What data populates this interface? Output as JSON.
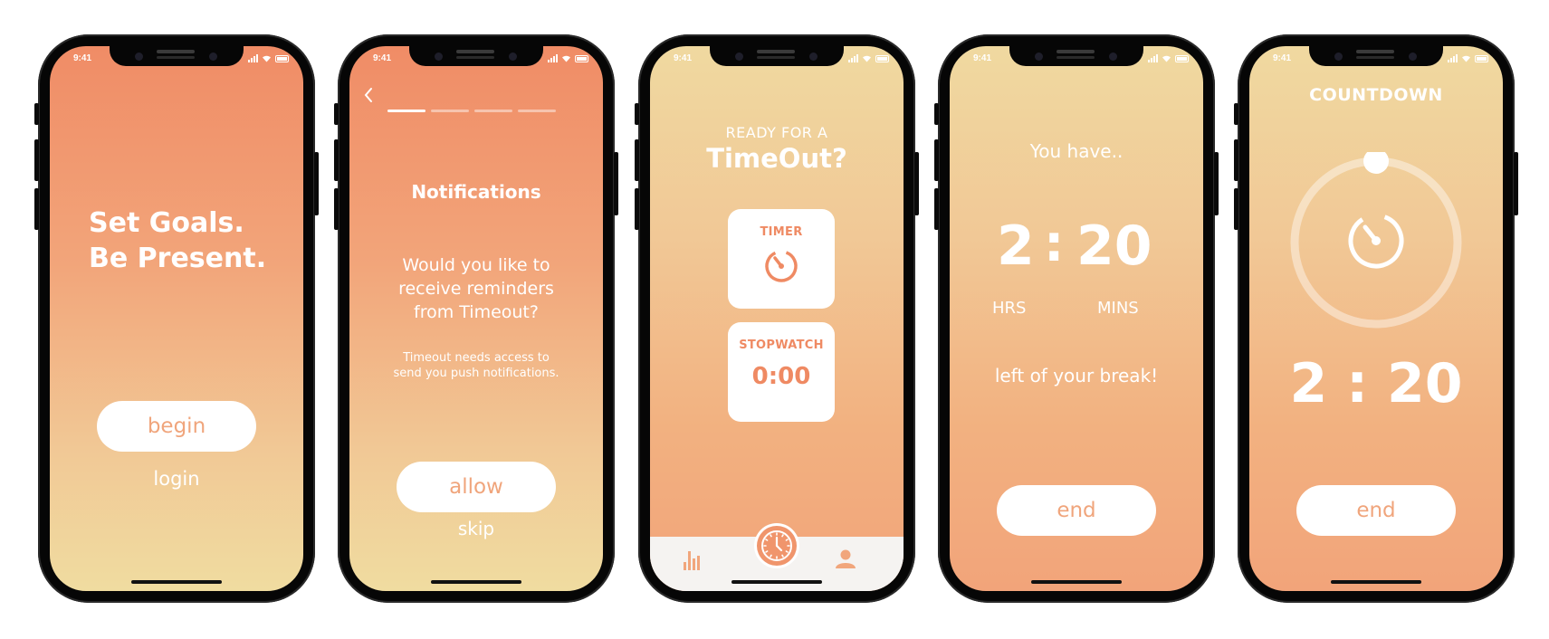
{
  "status": {
    "time": "9:41"
  },
  "screen1": {
    "headline_line1": "Set Goals.",
    "headline_line2": "Be Present.",
    "begin_button": "begin",
    "login_link": "login"
  },
  "screen2": {
    "title": "Notifications",
    "question": "Would you like to receive reminders from Timeout?",
    "description": "Timeout needs access to send you push notifications.",
    "progress_steps": 4,
    "progress_active_index": 0,
    "allow_button": "allow",
    "skip_link": "skip"
  },
  "screen3": {
    "subtitle": "READY FOR A",
    "title": "TimeOut?",
    "timer_card_label": "TIMER",
    "stopwatch_card_label": "STOPWATCH",
    "stopwatch_value": "0:00",
    "tabs": [
      "stats-icon",
      "clock-icon",
      "profile-icon"
    ]
  },
  "screen4": {
    "intro": "You have..",
    "hours": "2",
    "separator": ":",
    "minutes": "20",
    "hours_label": "HRS",
    "minutes_label": "MINS",
    "outro": "left of your break!",
    "end_button": "end"
  },
  "screen5": {
    "title": "COUNTDOWN",
    "time": "2 : 20",
    "progress_fraction": 0.0,
    "end_button": "end"
  },
  "colors": {
    "coral": "#f08c66",
    "sand": "#f0dca0",
    "accent": "#ef8a63",
    "button_text": "#f0a57c",
    "white": "#ffffff"
  }
}
